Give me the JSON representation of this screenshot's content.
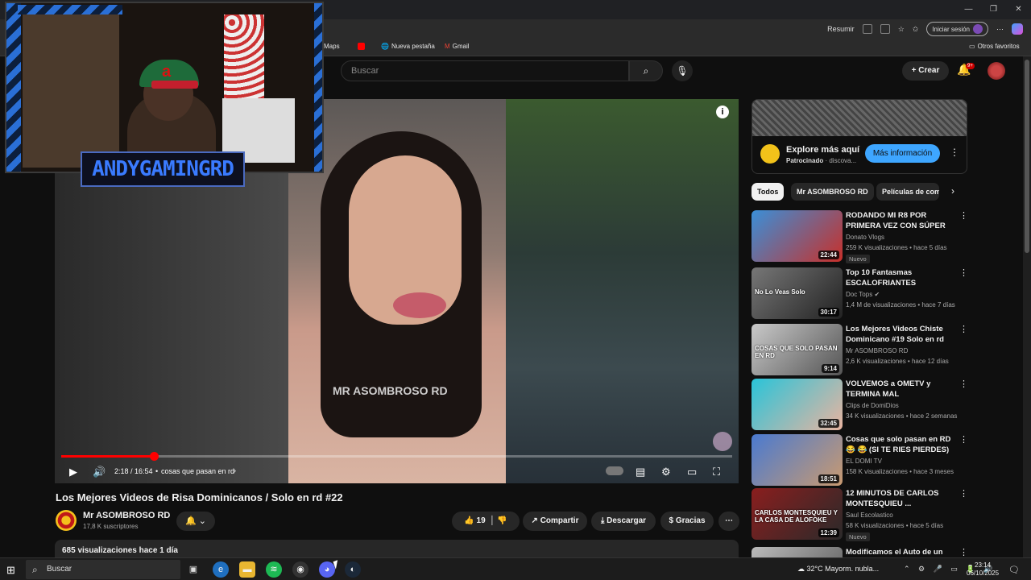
{
  "browser": {
    "resume_label": "Resumir",
    "signin_label": "Iniciar sesión",
    "window_controls": [
      "—",
      "❐",
      "✕"
    ],
    "bookmarks": [
      {
        "label": "Maps",
        "icon": "maps-icon"
      },
      {
        "label": "",
        "icon": "youtube-icon"
      },
      {
        "label": "Nueva pestaña",
        "icon": "globe-icon"
      },
      {
        "label": "Gmail",
        "icon": "gmail-icon"
      },
      {
        "label": "Otros favoritos",
        "icon": "folder-icon"
      }
    ]
  },
  "yt": {
    "search_placeholder": "Buscar",
    "create_label": "Crear",
    "notif_count": "9+"
  },
  "webcam": {
    "streamer_name": "ANDYGAMINGRD"
  },
  "player": {
    "watermark": "MR ASOMBROSO RD",
    "time": "2:18 / 16:54",
    "chapter": "cosas que pasan en rd",
    "progress": 0.138,
    "buffered": 0.18
  },
  "video": {
    "title": "Los Mejores Videos de Risa Dominicanos / Solo en rd #22",
    "channel": "Mr ASOMBROSO RD",
    "subscribers": "17,8 K suscriptores",
    "likes": "19",
    "share_label": "Compartir",
    "download_label": "Descargar",
    "thanks_label": "Gracias",
    "views_date": "685 visualizaciones  hace 1 día"
  },
  "ad": {
    "title": "Explore más aquí",
    "sponsored": "Patrocinado",
    "domain": "discova...",
    "button": "Más información"
  },
  "chips": [
    "Todos",
    "Mr ASOMBROSO RD",
    "Películas de com"
  ],
  "recommendations": [
    {
      "title": "RODANDO MI R8 POR PRIMERA VEZ CON SÚPER DEPORTIVOS...",
      "channel": "Donato Vlogs",
      "views": "259 K visualizaciones • hace 5 días",
      "duration": "22:44",
      "badge": "Nuevo",
      "verified": false,
      "thumb_colors": [
        "#3a8fd8",
        "#c8302a"
      ]
    },
    {
      "title": "Top 10 Fantasmas ESCALOFRIANTES Captados E...",
      "channel": "Doc Tops",
      "views": "1,4 M de visualizaciones • hace 7 días",
      "duration": "30:17",
      "badge": "",
      "verified": true,
      "thumb_label": "No Lo Veas Solo",
      "thumb_colors": [
        "#777",
        "#222"
      ]
    },
    {
      "title": "Los Mejores Videos Chiste Dominicano #19  Solo en rd",
      "channel": "Mr ASOMBROSO RD",
      "views": "2,6 K visualizaciones • hace 12 días",
      "duration": "9:14",
      "badge": "",
      "verified": false,
      "thumb_label": "COSAS QUE SOLO PASAN EN RD",
      "thumb_colors": [
        "#c9c9c9",
        "#555"
      ]
    },
    {
      "title": "VOLVEMOS a OMETV y TERMINA MAL",
      "channel": "Clips de DomiDios",
      "views": "34 K visualizaciones • hace 2 semanas",
      "duration": "32:45",
      "badge": "",
      "verified": false,
      "thumb_colors": [
        "#29c4d9",
        "#e9b4a0"
      ]
    },
    {
      "title": "Cosas que solo pasan en RD 😂 😂 (SI TE RIES PIERDES) ...",
      "channel": "EL DOMI TV",
      "views": "158 K visualizaciones • hace 3 meses",
      "duration": "18:51",
      "badge": "",
      "verified": false,
      "thumb_colors": [
        "#4a7ad0",
        "#c99a70"
      ]
    },
    {
      "title": "12 MINUTOS DE CARLOS MONTESQUIEU ...",
      "channel": "Saul Escolastico",
      "views": "58 K visualizaciones • hace 5 días",
      "duration": "12:39",
      "badge": "Nuevo",
      "verified": false,
      "thumb_label": "CARLOS MONTESQUIEU Y LA CASA DE ALOFOKE",
      "thumb_colors": [
        "#8a1e1e",
        "#2a2a2a"
      ]
    },
    {
      "title": "Modificamos el Auto de un",
      "channel": "",
      "views": "",
      "duration": "",
      "badge": "",
      "verified": false,
      "thumb_label": "14 DÍAS",
      "thumb_colors": [
        "#bbb",
        "#555"
      ]
    }
  ],
  "taskbar": {
    "search_label": "Buscar",
    "weather": "32°C  Mayorm. nubla...",
    "time": "23:14",
    "date": "06/10/2025"
  }
}
